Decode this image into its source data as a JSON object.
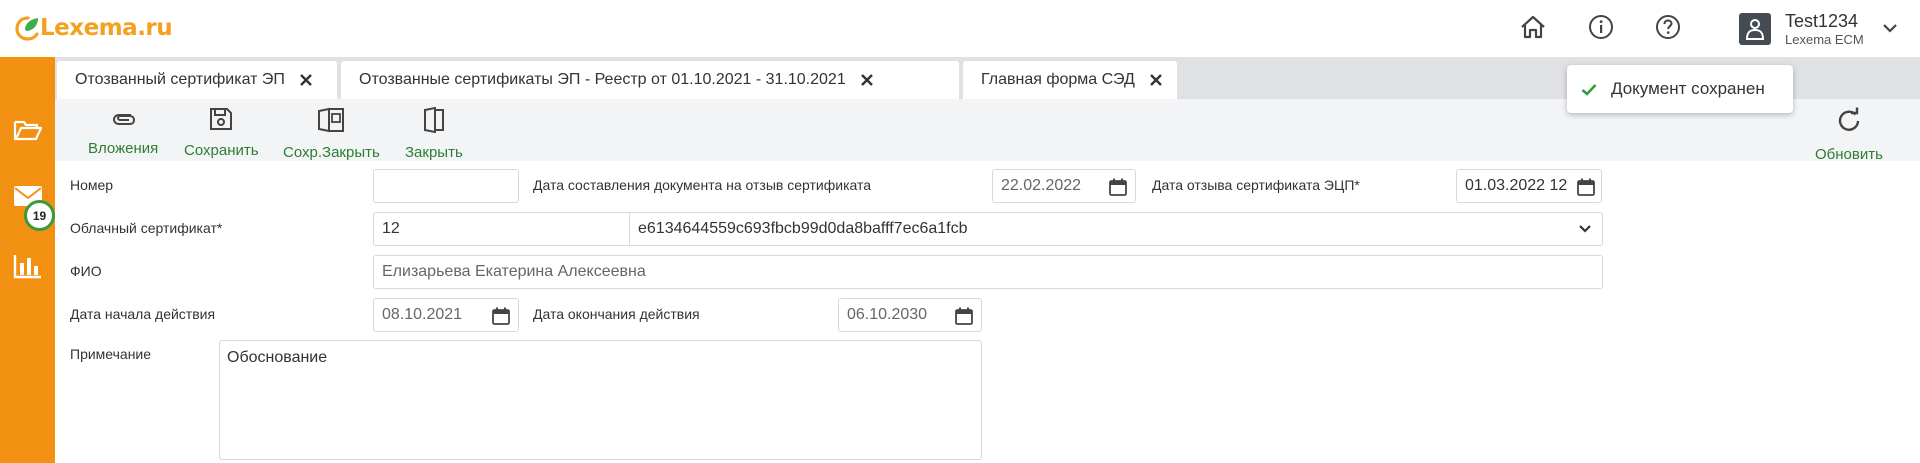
{
  "app": {
    "logo_main": "Lexema",
    "logo_suffix": ".ru"
  },
  "header": {
    "icons": [
      "home-icon",
      "info-icon",
      "help-icon"
    ],
    "user": {
      "name": "Test1234",
      "org": "Lexema ECM"
    }
  },
  "sidebar": {
    "items": [
      "folder-icon",
      "mail-icon",
      "chart-icon"
    ],
    "mail_badge": "19"
  },
  "tabs": [
    {
      "label": "Отозванный сертификат ЭП"
    },
    {
      "label": "Отозванные сертификаты ЭП - Реестр от 01.10.2021 - 31.10.2021"
    },
    {
      "label": "Главная форма СЭД"
    }
  ],
  "toast": {
    "message": "Документ сохранен"
  },
  "toolbar": {
    "attachments": "Вложения",
    "save": "Сохранить",
    "save_close": "Сохр.Закрыть",
    "close": "Закрыть",
    "refresh": "Обновить"
  },
  "form": {
    "number": {
      "label": "Номер",
      "value": ""
    },
    "doc_date": {
      "label": "Дата составления документа на отзыв сертификата",
      "value": "22.02.2022"
    },
    "revoke_date": {
      "label": "Дата отзыва сертификата ЭЦП*",
      "value": "01.03.2022 12"
    },
    "cloud_cert": {
      "label": "Облачный сертификат*",
      "code": "12",
      "value": "e6134644559c693fbcb99d0da8bafff7ec6a1fcb"
    },
    "fio": {
      "label": "ФИО",
      "value": "Елизарьева Екатерина Алексеевна"
    },
    "start_date": {
      "label": "Дата начала действия",
      "value": "08.10.2021"
    },
    "end_date": {
      "label": "Дата окончания действия",
      "value": "06.10.2030"
    },
    "note": {
      "label": "Примечание",
      "value": "Обоснование"
    }
  },
  "colors": {
    "accent": "#f29111",
    "action_green": "#2e7d32",
    "badge_ring": "#3a9a3a"
  }
}
